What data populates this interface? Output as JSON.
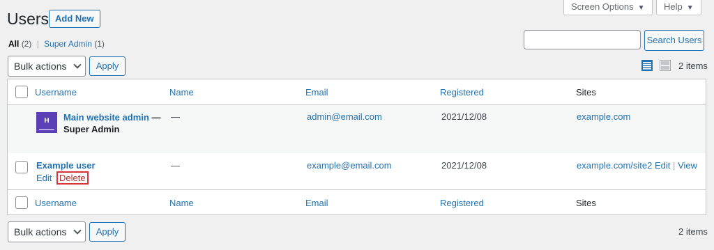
{
  "header": {
    "title": "Users",
    "add_new": "Add New",
    "screen_options": "Screen Options",
    "help": "Help"
  },
  "filters": {
    "all_label": "All",
    "all_count": "(2)",
    "super_admin_label": "Super Admin",
    "super_admin_count": "(1)"
  },
  "search": {
    "value": "",
    "button": "Search Users"
  },
  "tablenav_top": {
    "bulk_selected": "Bulk actions",
    "apply": "Apply",
    "items": "2 items"
  },
  "tablenav_bottom": {
    "bulk_selected": "Bulk actions",
    "apply": "Apply",
    "items": "2 items"
  },
  "columns": {
    "username": "Username",
    "name": "Name",
    "email": "Email",
    "registered": "Registered",
    "sites": "Sites"
  },
  "rows": [
    {
      "username": "Main website admin",
      "dash": "—",
      "role": "Super Admin",
      "name": "—",
      "email": "admin@email.com",
      "registered": "2021/12/08",
      "sites": "example.com",
      "avatar_text": "H"
    },
    {
      "username": "Example user",
      "name": "—",
      "email": "example@email.com",
      "registered": "2021/12/08",
      "sites": "example.com/site2",
      "site_edit": "Edit",
      "site_sep": "|",
      "site_view": "View",
      "action_edit": "Edit",
      "action_delete": "Delete"
    }
  ],
  "colors": {
    "link": "#2271b1",
    "delete": "#b32d2e",
    "highlight_border": "#d63638",
    "avatar": "#5b3fb5"
  }
}
